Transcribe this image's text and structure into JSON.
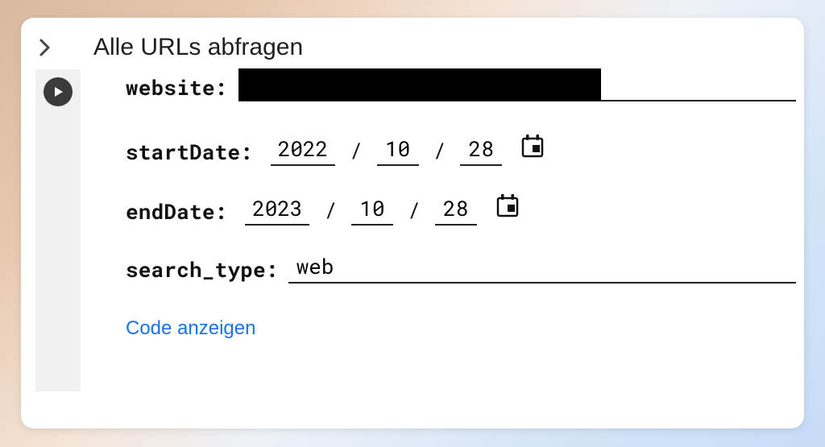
{
  "header": {
    "title": "Alle URLs abfragen"
  },
  "form": {
    "website_label": "website:",
    "startDate_label": "startDate:",
    "startDate": {
      "year": "2022",
      "month": "10",
      "day": "28"
    },
    "endDate_label": "endDate:",
    "endDate": {
      "year": "2023",
      "month": "10",
      "day": "28"
    },
    "search_type_label": "search_type:",
    "search_type_value": "web",
    "slash": "/"
  },
  "actions": {
    "show_code": "Code anzeigen"
  }
}
